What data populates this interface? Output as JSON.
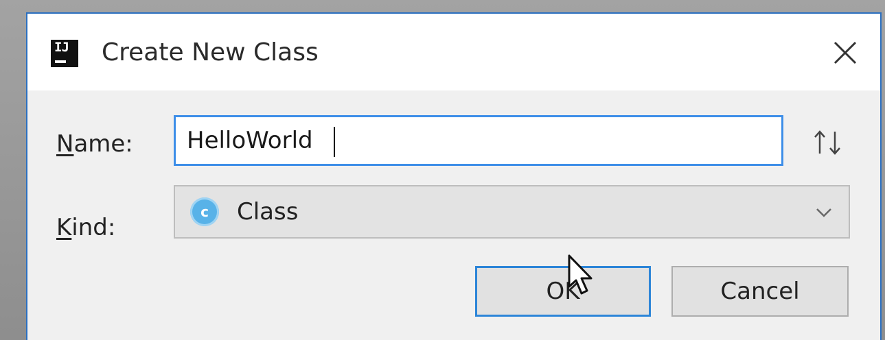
{
  "dialog": {
    "title": "Create New Class",
    "app_icon": "intellij-icon",
    "close_icon": "close-icon"
  },
  "form": {
    "name_label_mnemonic": "N",
    "name_label_rest": "ame:",
    "name_value": "HelloWorld",
    "sort_icon": "up-down-arrows-icon",
    "kind_label_mnemonic": "K",
    "kind_label_rest": "ind:",
    "kind_value": "Class",
    "kind_icon_letter": "c",
    "kind_icon": "class-icon",
    "kind_dropdown_icon": "chevron-down-icon"
  },
  "buttons": {
    "ok_label": "OK",
    "cancel_label": "Cancel"
  },
  "colors": {
    "focus_border": "#3d8ee8",
    "class_icon": "#58b2e8",
    "dialog_bg": "#f0f0f0",
    "titlebar_bg": "#ffffff"
  }
}
